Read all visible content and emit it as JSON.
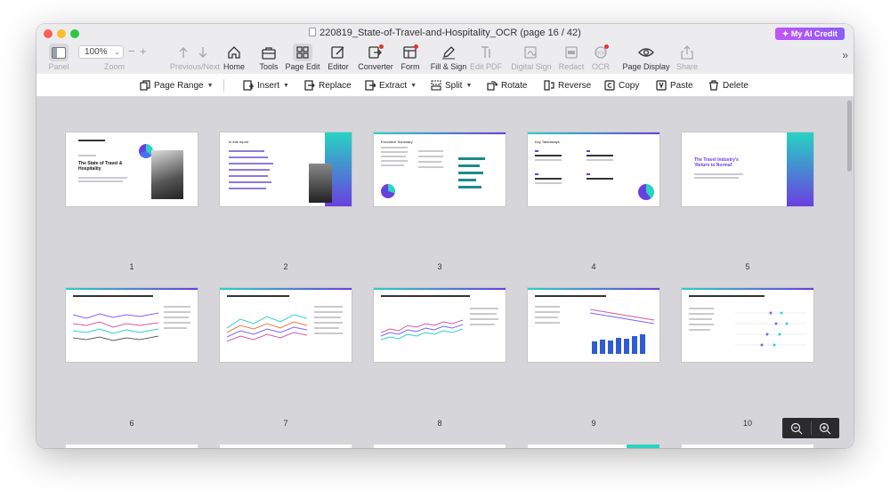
{
  "window": {
    "title": "220819_State-of-Travel-and-Hospitality_OCR (page 16 / 42)",
    "ai_button": "My AI Credit"
  },
  "toolbar": {
    "panel": "Panel",
    "zoom_value": "100%",
    "zoom_label": "Zoom",
    "prev_next": "Previous/Next",
    "home": "Home",
    "tools": "Tools",
    "page_edit": "Page Edit",
    "editor": "Editor",
    "converter": "Converter",
    "form": "Form",
    "fill_sign": "Fill & Sign",
    "edit_pdf": "Edit PDF",
    "digital_sign": "Digital Sign",
    "redact": "Redact",
    "ocr": "OCR",
    "page_display": "Page Display",
    "share": "Share"
  },
  "editbar": {
    "page_range": "Page Range",
    "insert": "Insert",
    "replace": "Replace",
    "extract": "Extract",
    "split": "Split",
    "rotate": "Rotate",
    "reverse": "Reverse",
    "copy": "Copy",
    "paste": "Paste",
    "delete": "Delete"
  },
  "pages": [
    {
      "num": "1",
      "heading": "The State of Travel & Hospitality"
    },
    {
      "num": "2",
      "heading": "In this report"
    },
    {
      "num": "3",
      "heading": "Executive Summary"
    },
    {
      "num": "4",
      "heading": "Key Takeaways"
    },
    {
      "num": "5",
      "heading": "The Travel Industry's 'Return to Normal'"
    },
    {
      "num": "6",
      "heading": ""
    },
    {
      "num": "7",
      "heading": ""
    },
    {
      "num": "8",
      "heading": ""
    },
    {
      "num": "9",
      "heading": ""
    },
    {
      "num": "10",
      "heading": ""
    }
  ],
  "colors": {
    "accent_teal": "#27d3c3",
    "accent_purple": "#6a3fe0",
    "ai_pink": "#c156f5"
  }
}
